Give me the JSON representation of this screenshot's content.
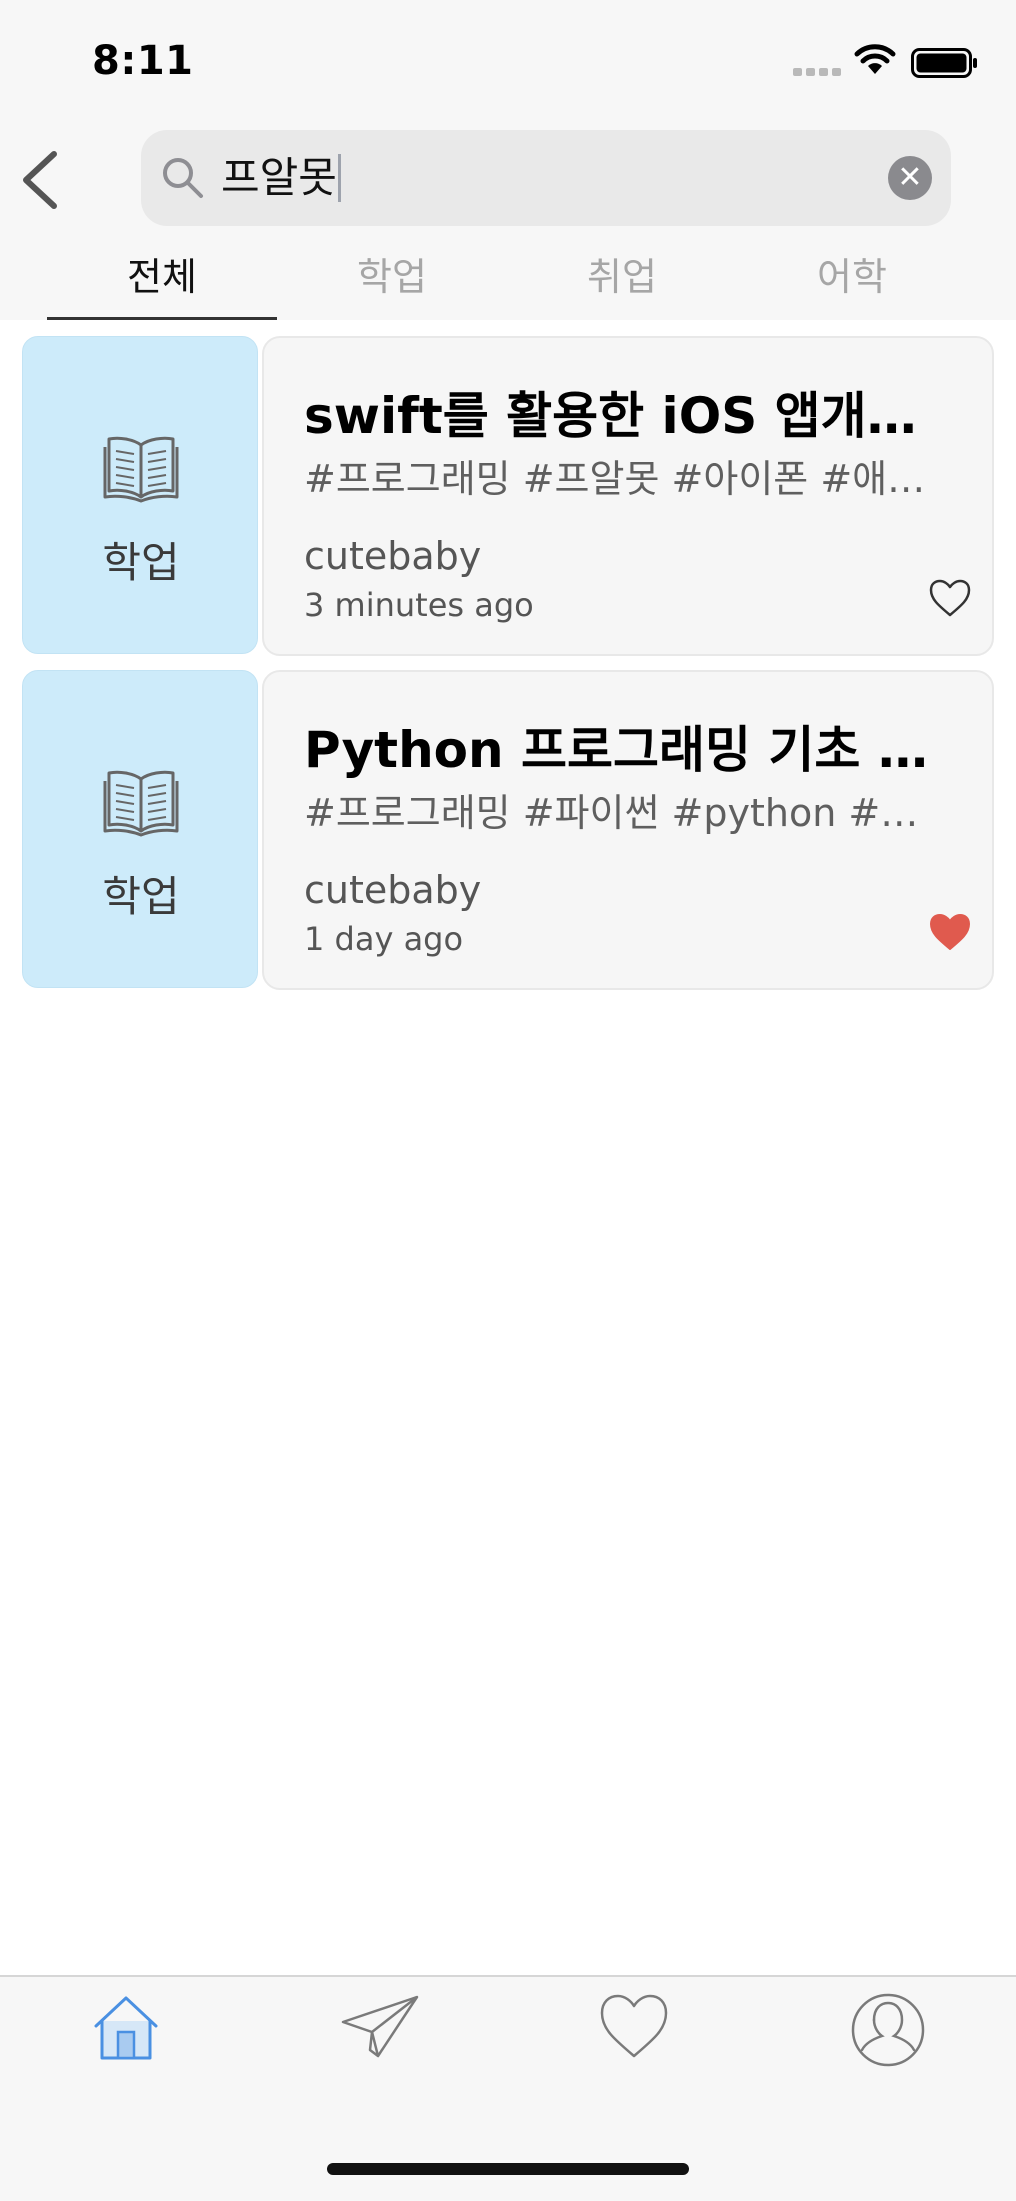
{
  "status_bar": {
    "time": "8:11"
  },
  "search": {
    "query": "프알못"
  },
  "tabs": [
    {
      "label": "전체",
      "active": true
    },
    {
      "label": "학업",
      "active": false
    },
    {
      "label": "취업",
      "active": false
    },
    {
      "label": "어학",
      "active": false
    }
  ],
  "results": [
    {
      "category": "학업",
      "title": "swift를 활용한 iOS 앱개발 스터디",
      "tags": "#프로그래밍 #프알못 #아이폰 #애플 #swift",
      "author": "cutebaby",
      "time": "3 minutes ago",
      "liked": false
    },
    {
      "category": "학업",
      "title": "Python 프로그래밍 기초 스터디",
      "tags": "#프로그래밍 #파이썬 #python #프알못",
      "author": "cutebaby",
      "time": "1 day ago",
      "liked": true
    }
  ],
  "tab_bar": {
    "items": [
      {
        "icon": "home-icon",
        "active": true
      },
      {
        "icon": "paper-plane-icon",
        "active": false
      },
      {
        "icon": "heart-icon",
        "active": false
      },
      {
        "icon": "profile-icon",
        "active": false
      }
    ]
  },
  "colors": {
    "thumbnail_bg": "#cdebfa",
    "active_tab_icon": "#4a90e2",
    "liked_heart": "#e05a4e",
    "inactive_icon": "#7a7a7a"
  }
}
